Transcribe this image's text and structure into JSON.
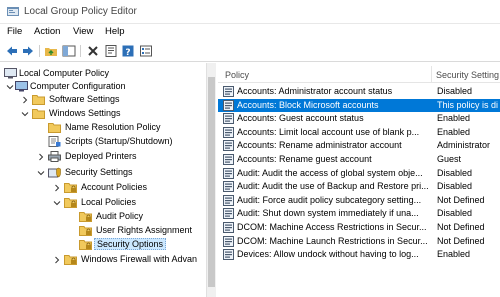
{
  "window": {
    "title": "Local Group Policy Editor"
  },
  "menu": [
    "File",
    "Action",
    "View",
    "Help"
  ],
  "toolbar": {
    "buttons": [
      "back-icon",
      "forward-icon",
      "up-folder-icon",
      "show-hide-tree-icon",
      "delete-icon",
      "properties-icon",
      "help-icon",
      "export-list-icon"
    ]
  },
  "tree": {
    "items": [
      {
        "label": "Local Computer Policy",
        "icon": "computer-policy-icon",
        "expanded": true
      },
      {
        "label": "Computer Configuration",
        "icon": "computer-icon",
        "expanded": true
      },
      {
        "label": "Software Settings",
        "icon": "folder-icon",
        "expanded": false
      },
      {
        "label": "Windows Settings",
        "icon": "folder-icon",
        "expanded": true
      },
      {
        "label": "Name Resolution Policy",
        "icon": "folder-icon"
      },
      {
        "label": "Scripts (Startup/Shutdown)",
        "icon": "scripts-icon"
      },
      {
        "label": "Deployed Printers",
        "icon": "printer-icon",
        "expanded": false
      },
      {
        "label": "Security Settings",
        "icon": "security-icon",
        "expanded": true
      },
      {
        "label": "Account Policies",
        "icon": "folder-lock-icon",
        "expanded": false
      },
      {
        "label": "Local Policies",
        "icon": "folder-lock-icon",
        "expanded": true
      },
      {
        "label": "Audit Policy",
        "icon": "folder-lock-icon"
      },
      {
        "label": "User Rights Assignment",
        "icon": "folder-lock-icon"
      },
      {
        "label": "Security Options",
        "icon": "folder-lock-icon",
        "selected": true
      },
      {
        "label": "Windows Firewall with Advan",
        "icon": "folder-lock-icon",
        "expanded": false
      }
    ]
  },
  "list": {
    "columns": [
      "Policy",
      "Security Setting"
    ],
    "rows": [
      {
        "policy": "Accounts: Administrator account status",
        "setting": "Disabled"
      },
      {
        "policy": "Accounts: Block Microsoft accounts",
        "setting": "This policy is di",
        "selected": true
      },
      {
        "policy": "Accounts: Guest account status",
        "setting": "Enabled"
      },
      {
        "policy": "Accounts: Limit local account use of blank p...",
        "setting": "Enabled"
      },
      {
        "policy": "Accounts: Rename administrator account",
        "setting": "Administrator"
      },
      {
        "policy": "Accounts: Rename guest account",
        "setting": "Guest"
      },
      {
        "policy": "Audit: Audit the access of global system obje...",
        "setting": "Disabled"
      },
      {
        "policy": "Audit: Audit the use of Backup and Restore pri...",
        "setting": "Disabled"
      },
      {
        "policy": "Audit: Force audit policy subcategory setting...",
        "setting": "Not Defined"
      },
      {
        "policy": "Audit: Shut down system immediately if una...",
        "setting": "Disabled"
      },
      {
        "policy": "DCOM: Machine Access Restrictions in Secur...",
        "setting": "Not Defined"
      },
      {
        "policy": "DCOM: Machine Launch Restrictions in Secur...",
        "setting": "Not Defined"
      },
      {
        "policy": "Devices: Allow undock without having to log...",
        "setting": "Enabled"
      }
    ]
  },
  "colors": {
    "selection": "#0078d7",
    "tree_selection": "#cce8ff",
    "folder": "#e8b84a"
  }
}
